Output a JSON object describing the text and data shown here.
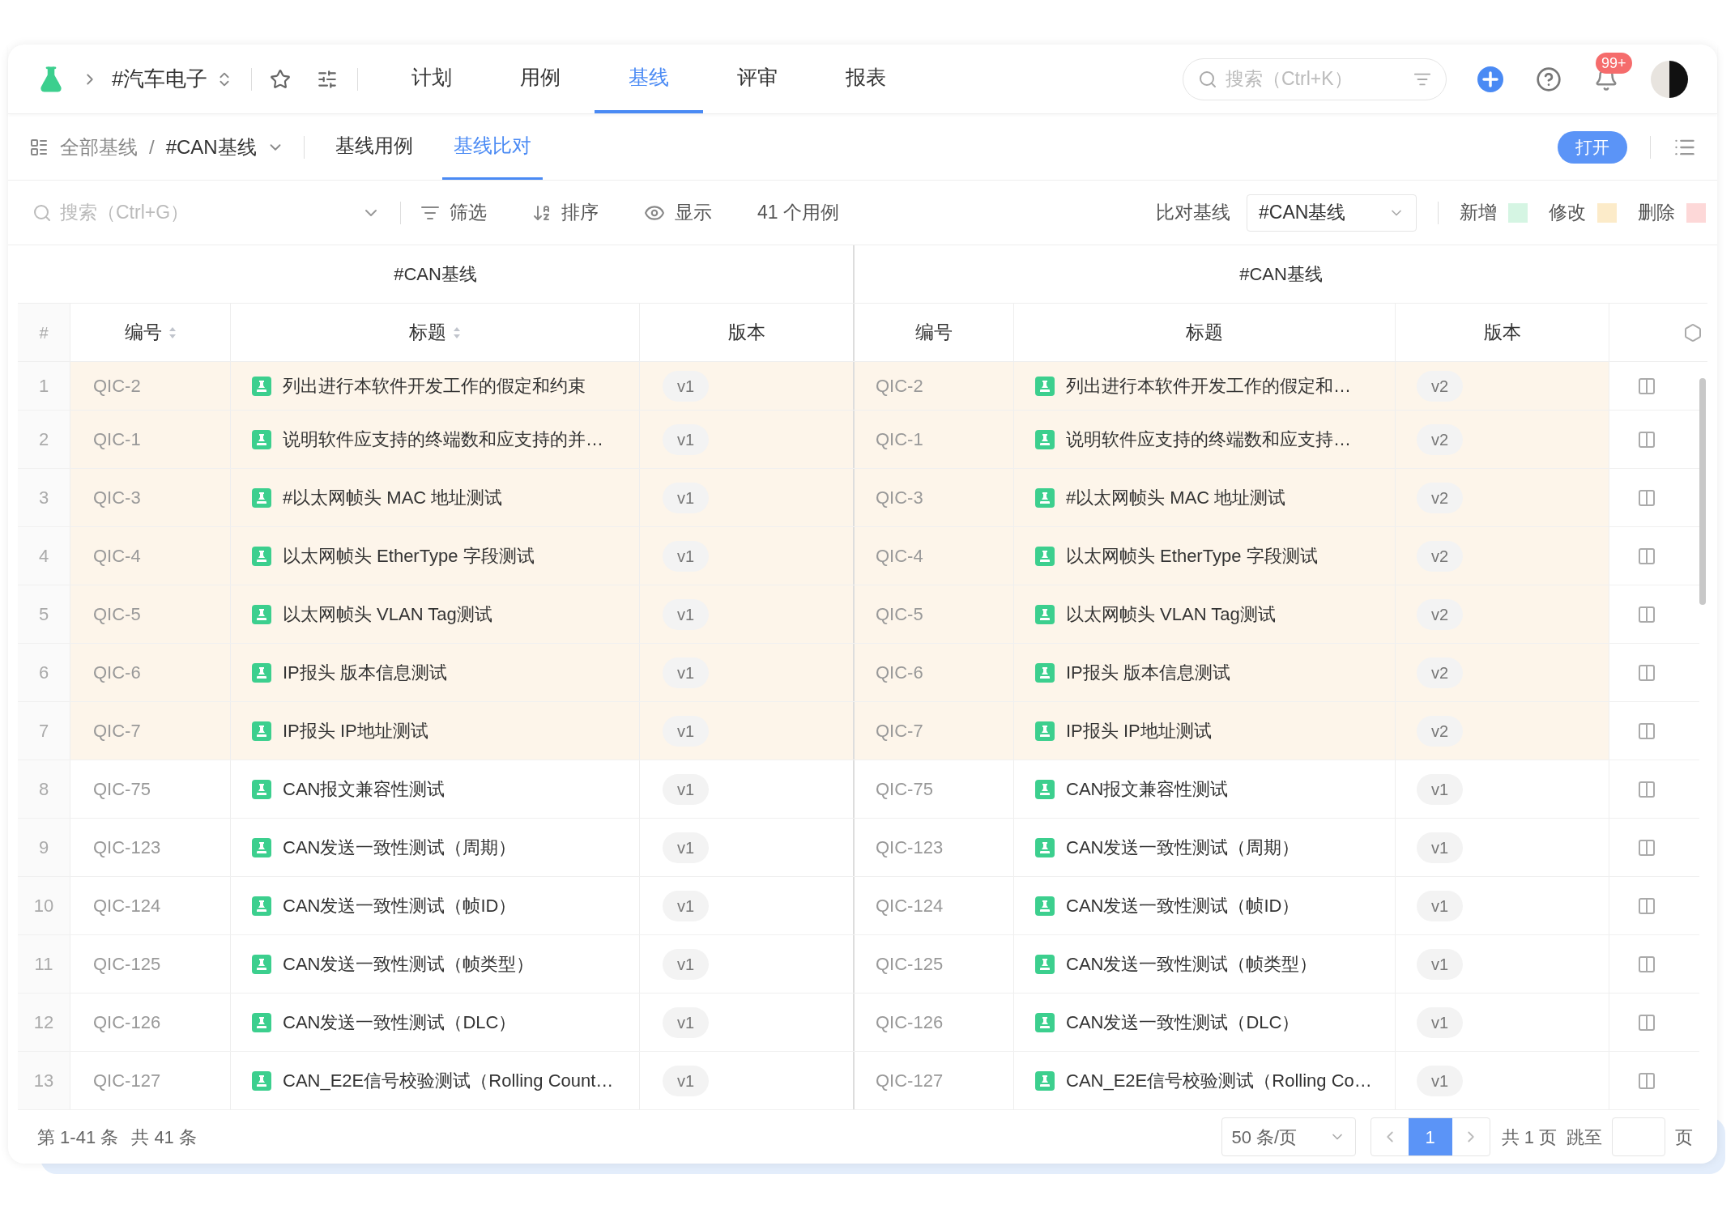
{
  "topbar": {
    "project": "#汽车电子",
    "tabs": [
      {
        "label": "计划",
        "selected": false
      },
      {
        "label": "用例",
        "selected": false
      },
      {
        "label": "基线",
        "selected": true
      },
      {
        "label": "评审",
        "selected": false
      },
      {
        "label": "报表",
        "selected": false
      }
    ],
    "search": {
      "placeholder": "搜索（Ctrl+K）"
    },
    "notification_badge": "99+"
  },
  "subnav": {
    "breadcrumb_root": "全部基线",
    "separator": "/",
    "baseline": "#CAN基线",
    "tabs": [
      {
        "label": "基线用例",
        "selected": false
      },
      {
        "label": "基线比对",
        "selected": true
      }
    ],
    "open_button": "打开"
  },
  "toolbar": {
    "search": {
      "placeholder": "搜索（Ctrl+G）"
    },
    "filter": "筛选",
    "sort": "排序",
    "display": "显示",
    "count": "41 个用例",
    "compare_label": "比对基线",
    "compare_value": "#CAN基线",
    "legend": [
      {
        "label": "新增",
        "color": "#d5f5e3"
      },
      {
        "label": "修改",
        "color": "#fcebc9"
      },
      {
        "label": "删除",
        "color": "#fdd8d8"
      }
    ]
  },
  "table": {
    "groups": [
      "#CAN基线",
      "#CAN基线"
    ],
    "left_columns": [
      {
        "label": "#",
        "sortable": false
      },
      {
        "label": "编号",
        "sortable": true
      },
      {
        "label": "标题",
        "sortable": true
      },
      {
        "label": "版本",
        "sortable": false
      }
    ],
    "right_columns": [
      {
        "label": "编号",
        "sortable": false
      },
      {
        "label": "标题",
        "sortable": false
      },
      {
        "label": "版本",
        "sortable": false
      }
    ],
    "rows": [
      {
        "index": "1",
        "changed": true,
        "left": {
          "id": "QIC-2",
          "title": "列出进行本软件开发工作的假定和约束",
          "version": "v1"
        },
        "right": {
          "id": "QIC-2",
          "title": "列出进行本软件开发工作的假定和…",
          "version": "v2"
        }
      },
      {
        "index": "2",
        "changed": true,
        "left": {
          "id": "QIC-1",
          "title": "说明软件应支持的终端数和应支持的并…",
          "version": "v1"
        },
        "right": {
          "id": "QIC-1",
          "title": "说明软件应支持的终端数和应支持…",
          "version": "v2"
        }
      },
      {
        "index": "3",
        "changed": true,
        "left": {
          "id": "QIC-3",
          "title": "#以太网帧头 MAC 地址测试",
          "version": "v1"
        },
        "right": {
          "id": "QIC-3",
          "title": "#以太网帧头 MAC 地址测试",
          "version": "v2"
        }
      },
      {
        "index": "4",
        "changed": true,
        "left": {
          "id": "QIC-4",
          "title": "以太网帧头 EtherType 字段测试",
          "version": "v1"
        },
        "right": {
          "id": "QIC-4",
          "title": "以太网帧头 EtherType 字段测试",
          "version": "v2"
        }
      },
      {
        "index": "5",
        "changed": true,
        "left": {
          "id": "QIC-5",
          "title": "以太网帧头 VLAN Tag测试",
          "version": "v1"
        },
        "right": {
          "id": "QIC-5",
          "title": "以太网帧头 VLAN Tag测试",
          "version": "v2"
        }
      },
      {
        "index": "6",
        "changed": true,
        "left": {
          "id": "QIC-6",
          "title": "IP报头 版本信息测试",
          "version": "v1"
        },
        "right": {
          "id": "QIC-6",
          "title": "IP报头 版本信息测试",
          "version": "v2"
        }
      },
      {
        "index": "7",
        "changed": true,
        "left": {
          "id": "QIC-7",
          "title": "IP报头 IP地址测试",
          "version": "v1"
        },
        "right": {
          "id": "QIC-7",
          "title": "IP报头 IP地址测试",
          "version": "v2"
        }
      },
      {
        "index": "8",
        "changed": false,
        "left": {
          "id": "QIC-75",
          "title": "CAN报文兼容性测试",
          "version": "v1"
        },
        "right": {
          "id": "QIC-75",
          "title": "CAN报文兼容性测试",
          "version": "v1"
        }
      },
      {
        "index": "9",
        "changed": false,
        "left": {
          "id": "QIC-123",
          "title": "CAN发送一致性测试（周期）",
          "version": "v1"
        },
        "right": {
          "id": "QIC-123",
          "title": "CAN发送一致性测试（周期）",
          "version": "v1"
        }
      },
      {
        "index": "10",
        "changed": false,
        "left": {
          "id": "QIC-124",
          "title": "CAN发送一致性测试（帧ID）",
          "version": "v1"
        },
        "right": {
          "id": "QIC-124",
          "title": "CAN发送一致性测试（帧ID）",
          "version": "v1"
        }
      },
      {
        "index": "11",
        "changed": false,
        "left": {
          "id": "QIC-125",
          "title": "CAN发送一致性测试（帧类型）",
          "version": "v1"
        },
        "right": {
          "id": "QIC-125",
          "title": "CAN发送一致性测试（帧类型）",
          "version": "v1"
        }
      },
      {
        "index": "12",
        "changed": false,
        "left": {
          "id": "QIC-126",
          "title": "CAN发送一致性测试（DLC）",
          "version": "v1"
        },
        "right": {
          "id": "QIC-126",
          "title": "CAN发送一致性测试（DLC）",
          "version": "v1"
        }
      },
      {
        "index": "13",
        "changed": false,
        "left": {
          "id": "QIC-127",
          "title": "CAN_E2E信号校验测试（Rolling Count…",
          "version": "v1"
        },
        "right": {
          "id": "QIC-127",
          "title": "CAN_E2E信号校验测试（Rolling Co…",
          "version": "v1"
        }
      }
    ]
  },
  "footer": {
    "range": "第 1-41 条",
    "total": "共 41 条",
    "page_size": "50 条/页",
    "pages": [
      {
        "label": "1",
        "selected": true
      }
    ],
    "page_count": "共 1 页",
    "jump_label": "跳至",
    "jump_suffix": "页"
  }
}
